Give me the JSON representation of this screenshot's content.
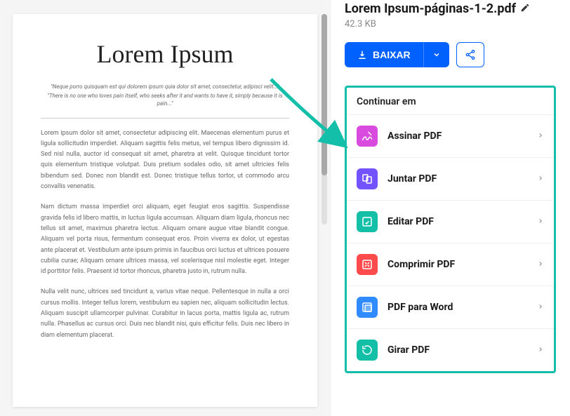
{
  "document": {
    "title": "Lorem Ipsum",
    "quote1": "\"Neque porro quisquam est qui dolorem ipsum quia dolor sit amet, consectetur, adipisci velit...\"",
    "quote2": "\"There is no one who loves pain itself, who seeks after it and wants to have it, simply because it is pain...\"",
    "para1": "Lorem ipsum dolor sit amet, consectetur adipiscing elit. Maecenas elementum purus et ligula sollicitudin imperdiet. Aliquam sagittis felis metus, vel tempus libero dignissim id. Sed nisl nulla, auctor id consequat sit amet, pharetra at velit. Quisque tincidunt tortor quis elementum tristique volutpat. Duis pretium sodales odio, sit amet ultricies felis bibendum sed. Donec non blandit est. Donec tristique tellus tortor, ut commodo arcu convallis venenatis.",
    "para2": "Nam dictum massa imperdiet orci aliquam, eget feugiat eros sagittis. Suspendisse gravida felis id libero mattis, in luctus ligula accumsan. Aliquam diam ligula, rhoncus nec tellus sit amet, maximus pharetra lectus. Aliquam ornare augue vitae blandit congue. Aliquam vel porta risus, fermentum consequat eros. Proin viverra ex dolor, ut egestas ante placerat et. Vestibulum ante ipsum primis in faucibus orci luctus et ultrices posuere cubilia curae; Aliquam ornare ultrices massa, vel scelerisque nisl molestie eget. Integer id porttitor felis. Praesent id tortor rhoncus, pharetra justo in, rutrum nulla.",
    "para3": "Nulla velit nunc, ultrices sed tincidunt a, varius vitae neque. Pellentesque in nulla a orci cursus mollis. Integer tellus lorem, vestibulum eu sapien nec, aliquam sollicitudin lectus. Aliquam suscipit ullamcorper pulvinar. Curabitur in lacus porta, mattis ligula ac, rutrum nulla. Phasellus ac cursus orci. Duis nec blandit nisi, quis efficitur felis. Duis nec libero in diam elementum placerat."
  },
  "file": {
    "name": "Lorem Ipsum-páginas-1-2.pdf",
    "size": "42.3 KB"
  },
  "buttons": {
    "download": "BAIXAR"
  },
  "continue": {
    "title": "Continuar em",
    "items": [
      {
        "label": "Assinar PDF",
        "icon": "sign",
        "color": "#d94bdf"
      },
      {
        "label": "Juntar PDF",
        "icon": "merge",
        "color": "#7353ff"
      },
      {
        "label": "Editar PDF",
        "icon": "edit",
        "color": "#14bfa8"
      },
      {
        "label": "Comprimir PDF",
        "icon": "compress",
        "color": "#ff4b4b"
      },
      {
        "label": "PDF para Word",
        "icon": "word",
        "color": "#2f8bff"
      },
      {
        "label": "Girar PDF",
        "icon": "rotate",
        "color": "#14bfa8"
      }
    ]
  }
}
